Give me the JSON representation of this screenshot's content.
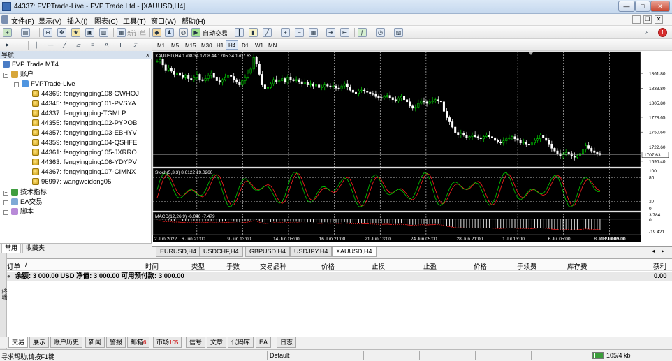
{
  "window": {
    "title": "44337: FVPTrade-Live - FVP Trade Ltd - [XAUUSD,H4]"
  },
  "menu": [
    "文件(F)",
    "显示(V)",
    "插入(I)",
    "图表(C)",
    "工具(T)",
    "窗口(W)",
    "帮助(H)"
  ],
  "toolbar": {
    "new_order": "新订单",
    "auto_trading": "自动交易"
  },
  "timeframes": [
    "M1",
    "M5",
    "M15",
    "M30",
    "H1",
    "H4",
    "D1",
    "W1",
    "MN"
  ],
  "timeframe_active": "H4",
  "navigator": {
    "header": "导航",
    "root": "FVP Trade MT4",
    "accounts_label": "账户",
    "server": "FVPTrade-Live",
    "accounts": [
      "44369: fengyingping108-GWHOJ",
      "44345: fengyingping101-PVSYA",
      "44337: fengyingping-TGMLP",
      "44355: fengyingping102-PYPOB",
      "44357: fengyingping103-EBHYV",
      "44359: fengyingping104-QSHFE",
      "44361: fengyingping105-JXRRO",
      "44363: fengyingping106-YDYPV",
      "44367: fengyingping107-CIMNX",
      "96997: wangweidong05"
    ],
    "sections": [
      "技术指标",
      "EA交易",
      "脚本"
    ],
    "tabs": [
      "常用",
      "收藏夹"
    ]
  },
  "chart_data": {
    "type": "candlestick",
    "symbol_label": "XAUUSD,H4  1708.34 1708.44 1705.34 1707.63",
    "price_ticks": [
      "1861.80",
      "1833.80",
      "1805.80",
      "1778.65",
      "1750.60",
      "1722.60",
      "1695.40"
    ],
    "current_price": "1707.63",
    "ylim": [
      1695.4,
      1875
    ],
    "close_series": [
      1885,
      1888,
      1878,
      1868,
      1872,
      1866,
      1860,
      1863,
      1858,
      1855,
      1858,
      1852,
      1850,
      1855,
      1860,
      1850,
      1848,
      1852,
      1858,
      1862,
      1855,
      1848,
      1845,
      1850,
      1855,
      1858,
      1856,
      1850,
      1845,
      1840,
      1848,
      1855,
      1862,
      1870,
      1892,
      1880,
      1860,
      1840,
      1832,
      1835,
      1842,
      1850,
      1846,
      1848,
      1852,
      1845,
      1855,
      1850,
      1848,
      1850,
      1846,
      1842,
      1845,
      1840,
      1842,
      1838,
      1840,
      1835,
      1836,
      1840,
      1838,
      1836,
      1838,
      1834,
      1832,
      1838,
      1842,
      1836,
      1830,
      1826,
      1824,
      1828,
      1830,
      1828,
      1826,
      1824,
      1822,
      1818,
      1816,
      1815,
      1818,
      1820,
      1816,
      1812,
      1810,
      1815,
      1818,
      1812,
      1808,
      1800,
      1796,
      1798,
      1805,
      1810,
      1808,
      1805,
      1808,
      1810,
      1812,
      1810,
      1808,
      1790,
      1778,
      1770,
      1760,
      1750,
      1745,
      1748,
      1745,
      1740,
      1742,
      1745,
      1742,
      1740,
      1738,
      1742,
      1745,
      1742,
      1740,
      1735,
      1732,
      1730,
      1734,
      1738,
      1740,
      1742,
      1738,
      1735,
      1730,
      1732,
      1728,
      1726,
      1730,
      1735,
      1738,
      1745,
      1740,
      1735,
      1728,
      1720,
      1715,
      1710,
      1705,
      1708,
      1712,
      1710,
      1705,
      1703,
      1706,
      1710,
      1718,
      1725,
      1720,
      1715,
      1712,
      1710,
      1708
    ],
    "stoch": {
      "label": "Stoch(5,3,3) 8.6122 19.0260",
      "ticks": [
        "100",
        "80",
        "20",
        "0"
      ]
    },
    "macd": {
      "label": "MACD(12,26,9) -6.046 -7.479",
      "ticks": [
        "3.784",
        "0",
        "-19.421"
      ]
    },
    "time_ticks": [
      "2 Jun 2022",
      "6 Jun 21:00",
      "9 Jun 13:00",
      "14 Jun 05:00",
      "16 Jun 21:00",
      "21 Jun 13:00",
      "24 Jun 05:00",
      "28 Jun 21:00",
      "1 Jul 13:00",
      "6 Jul 05:00",
      "8 Jul 21:00",
      "13 Jul 13:00",
      "18 Jul 05:00"
    ],
    "colors": {
      "bull": "#00d000",
      "bear": "#ffffff",
      "bg": "#000000",
      "main_line": "#00c800",
      "signal_line": "#ff2020"
    }
  },
  "chart_tabs": [
    "EURUSD,H4",
    "USDCHF,H4",
    "GBPUSD,H4",
    "USDJPY,H4",
    "XAUUSD,H4"
  ],
  "chart_tab_active": "XAUUSD,H4",
  "terminal": {
    "columns": [
      "订单",
      "/",
      "时间",
      "类型",
      "手数",
      "交易品种",
      "价格",
      "止损",
      "止盈",
      "价格",
      "手续费",
      "库存费",
      "获利"
    ],
    "balance_row": "余额: 3 000.00 USD  净值: 3 000.00  可用预付款: 3 000.00",
    "balance_profit": "0.00",
    "tabs": [
      {
        "label": "交易",
        "badge": ""
      },
      {
        "label": "展示",
        "badge": ""
      },
      {
        "label": "账户历史",
        "badge": ""
      },
      {
        "label": "新闻",
        "badge": ""
      },
      {
        "label": "警报",
        "badge": ""
      },
      {
        "label": "邮箱",
        "badge": "6"
      },
      {
        "label": "市场",
        "badge": "105"
      },
      {
        "label": "信号",
        "badge": ""
      },
      {
        "label": "文章",
        "badge": ""
      },
      {
        "label": "代码库",
        "badge": ""
      },
      {
        "label": "EA",
        "badge": ""
      },
      {
        "label": "日志",
        "badge": ""
      }
    ],
    "side_label": "终端"
  },
  "status": {
    "help": "寻求帮助,请按F1键",
    "profile": "Default",
    "traffic": "105/4 kb"
  }
}
